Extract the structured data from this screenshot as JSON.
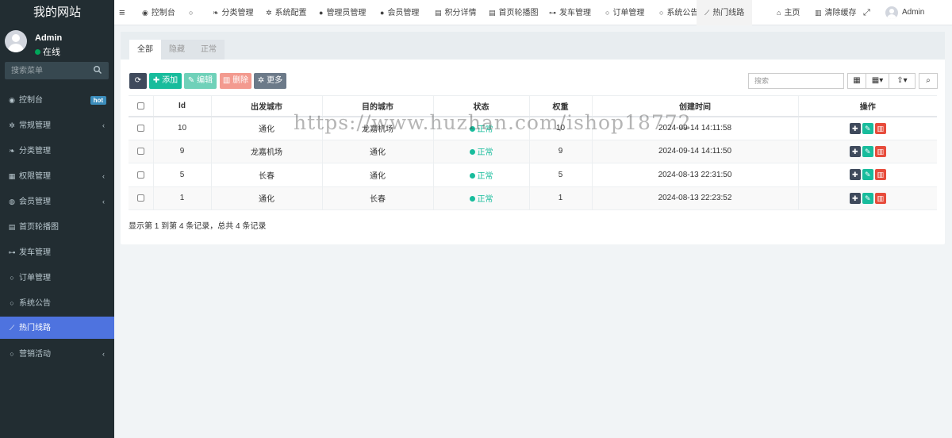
{
  "sidebar": {
    "brand": "我的网站",
    "user": {
      "name": "Admin",
      "status": "在线"
    },
    "search_placeholder": "搜索菜单",
    "items": [
      {
        "label": "控制台",
        "icon": "dashboard-icon",
        "glyph": "◉",
        "badge": "hot"
      },
      {
        "label": "常规管理",
        "icon": "cogs-icon",
        "glyph": "✲",
        "has_children": true
      },
      {
        "label": "分类管理",
        "icon": "leaf-icon",
        "glyph": "❧"
      },
      {
        "label": "权限管理",
        "icon": "group-icon",
        "glyph": "▦",
        "has_children": true
      },
      {
        "label": "会员管理",
        "icon": "user-circle-icon",
        "glyph": "◍",
        "has_children": true
      },
      {
        "label": "首页轮播图",
        "icon": "film-icon",
        "glyph": "▤"
      },
      {
        "label": "发车管理",
        "icon": "car-icon",
        "glyph": "⊶"
      },
      {
        "label": "订单管理",
        "icon": "circle-o-icon",
        "glyph": "○"
      },
      {
        "label": "系统公告",
        "icon": "circle-o-icon",
        "glyph": "○"
      },
      {
        "label": "热门线路",
        "icon": "line-chart-icon",
        "glyph": "⟋",
        "active": true
      },
      {
        "label": "营销活动",
        "icon": "circle-o-icon",
        "glyph": "○",
        "has_children": true
      }
    ]
  },
  "topnav": {
    "tabs": [
      {
        "label": "控制台",
        "icon": "dashboard-icon",
        "glyph": "◉"
      },
      {
        "label": "",
        "icon": "circle-o-icon",
        "glyph": "○"
      },
      {
        "label": "分类管理",
        "icon": "leaf-icon",
        "glyph": "❧"
      },
      {
        "label": "系统配置",
        "icon": "cog-icon",
        "glyph": "✲"
      },
      {
        "label": "管理员管理",
        "icon": "user-icon",
        "glyph": "●"
      },
      {
        "label": "会员管理",
        "icon": "user-icon",
        "glyph": "●"
      },
      {
        "label": "积分详情",
        "icon": "list-icon",
        "glyph": "▤"
      },
      {
        "label": "首页轮播图",
        "icon": "film-icon",
        "glyph": "▤"
      },
      {
        "label": "发车管理",
        "icon": "car-icon",
        "glyph": "⊶"
      },
      {
        "label": "订单管理",
        "icon": "circle-o-icon",
        "glyph": "○"
      },
      {
        "label": "系统公告",
        "icon": "circle-o-icon",
        "glyph": "○"
      },
      {
        "label": "热门线路",
        "icon": "line-chart-icon",
        "glyph": "⟋",
        "active": true
      }
    ],
    "home": "主页",
    "clear_cache": "清除缓存",
    "username": "Admin"
  },
  "filters": [
    "全部",
    "隐藏",
    "正常"
  ],
  "toolbar": {
    "add": "添加",
    "edit": "编辑",
    "delete": "删除",
    "more": "更多",
    "search_placeholder": "搜索"
  },
  "table": {
    "columns": [
      "Id",
      "出发城市",
      "目的城市",
      "状态",
      "权重",
      "创建时间",
      "操作"
    ],
    "rows": [
      {
        "id": "10",
        "from": "通化",
        "to": "龙嘉机场",
        "status": "正常",
        "weight": "10",
        "created": "2024-09-14 14:11:58"
      },
      {
        "id": "9",
        "from": "龙嘉机场",
        "to": "通化",
        "status": "正常",
        "weight": "9",
        "created": "2024-09-14 14:11:50"
      },
      {
        "id": "5",
        "from": "长春",
        "to": "通化",
        "status": "正常",
        "weight": "5",
        "created": "2024-08-13 22:31:50"
      },
      {
        "id": "1",
        "from": "通化",
        "to": "长春",
        "status": "正常",
        "weight": "1",
        "created": "2024-08-13 22:23:52"
      }
    ]
  },
  "pagination_info": "显示第 1 到第 4 条记录，总共 4 条记录",
  "watermark": "https://www.huzhan.com/ishop18772",
  "colors": {
    "sidebar_bg": "#222d32",
    "accent": "#4e73df",
    "success": "#18bc9c",
    "danger": "#e74c3c",
    "dark_btn": "#3f4a5c"
  }
}
